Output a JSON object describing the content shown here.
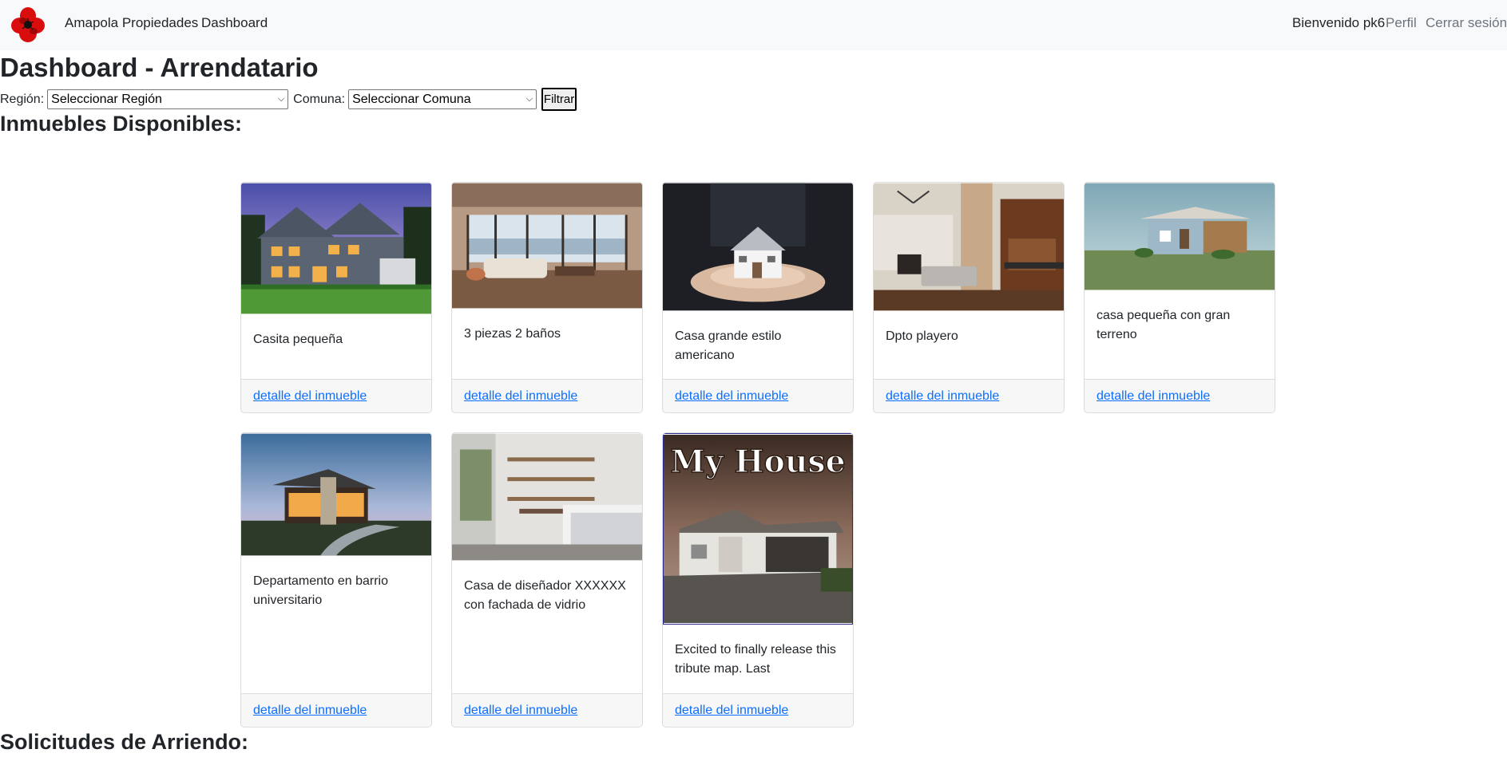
{
  "navbar": {
    "brand": "Amapola Propiedades",
    "dashboard": "Dashboard",
    "welcome": "Bienvenido pk6",
    "profile": "Perfil",
    "logout": "Cerrar sesión"
  },
  "page": {
    "title": "Dashboard - Arrendatario"
  },
  "filters": {
    "region_label": "Región:",
    "region_value": "Seleccionar Región",
    "comuna_label": "Comuna:",
    "comuna_value": "Seleccionar Comuna",
    "button": "Filtrar"
  },
  "sections": {
    "inmuebles": "Inmuebles Disponibles:",
    "solicitudes": "Solicitudes de Arriendo:"
  },
  "cards": [
    {
      "title": "Casita pequeña",
      "link": "detalle del inmueble"
    },
    {
      "title": "3 piezas 2 baños",
      "link": "detalle del inmueble"
    },
    {
      "title": "Casa grande estilo americano",
      "link": "detalle del inmueble"
    },
    {
      "title": "Dpto playero",
      "link": "detalle del inmueble"
    },
    {
      "title": "casa pequeña con gran terreno",
      "link": "detalle del inmueble"
    },
    {
      "title": "Departamento en barrio universitario",
      "link": "detalle del inmueble"
    },
    {
      "title": "Casa de diseñador XXXXXX con fachada de vidrio",
      "link": "detalle del inmueble"
    },
    {
      "title": "Excited to finally release this tribute map. Last",
      "link": "detalle del inmueble",
      "image_text": "My House"
    }
  ]
}
